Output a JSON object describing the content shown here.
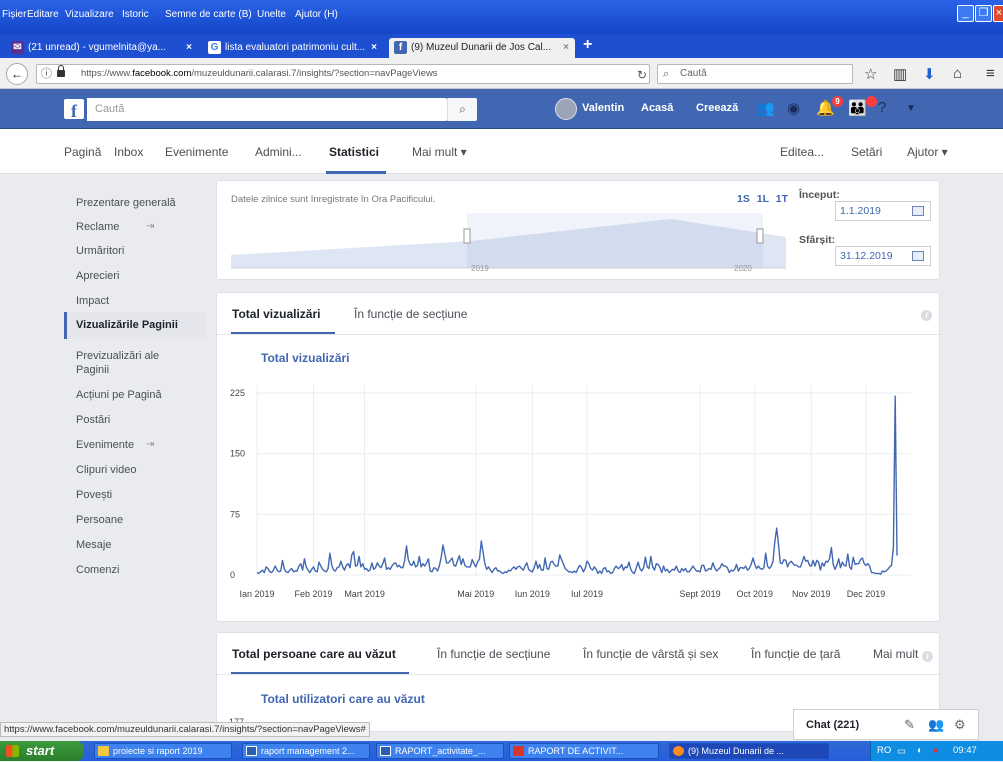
{
  "menubar": {
    "items": [
      "Fișier",
      "Editare",
      "Vizualizare",
      "Istoric",
      "Semne de carte (B)",
      "Unelte",
      "Ajutor (H)"
    ]
  },
  "tabs": [
    {
      "label": "(21 unread) - vgumelnita@ya...",
      "icon": "mail-icon"
    },
    {
      "label": "lista evaluatori patrimoniu cult...",
      "icon": "google-icon"
    },
    {
      "label": "(9) Muzeul Dunarii de Jos Cal...",
      "icon": "facebook-icon"
    }
  ],
  "navbar": {
    "url_prefix": "https://www.",
    "url_domain": "facebook.com",
    "url_path": "/muzeuldunarii.calarasi.7/insights/?section=navPageViews",
    "search_placeholder": "Caută"
  },
  "fb": {
    "search_placeholder": "Caută",
    "user_name": "Valentin",
    "home": "Acasă",
    "create": "Creează",
    "notif_count": "9"
  },
  "page_tabs": [
    "Pagină",
    "Inbox",
    "Evenimente",
    "Admini...",
    "Statistici",
    "Mai mult ▾",
    "Editea...",
    "Setări",
    "Ajutor ▾"
  ],
  "leftnav": [
    "Prezentare generală",
    "Reclame",
    "Urmăritori",
    "Aprecieri",
    "Impact",
    "Vizualizările Paginii",
    "Previzualizări ale Paginii",
    "Acțiuni pe Pagină",
    "Postări",
    "Evenimente",
    "Clipuri video",
    "Povești",
    "Persoane",
    "Mesaje",
    "Comenzi"
  ],
  "daterange": {
    "note": "Datele zilnice sunt înregistrate în Ora Pacificului.",
    "periods": "1S 1L 1T",
    "start_label": "Început:",
    "start_value": "1.1.2019",
    "end_label": "Sfârșit:",
    "end_value": "31.12.2019",
    "timeline_labels": [
      "2019",
      "2020"
    ]
  },
  "views_card": {
    "tab_total": "Total vizualizări",
    "tab_section": "În funcție de secțiune",
    "chart_title": "Total vizualizări"
  },
  "reach_card": {
    "tabs": [
      "Total persoane care au văzut",
      "În funcție de secțiune",
      "În funcție de vârstă și sex",
      "În funcție de țară",
      "Mai mult"
    ],
    "chart_title": "Total utilizatori care au văzut",
    "partial_tick": "177"
  },
  "chart_data": {
    "type": "line",
    "title": "Total vizualizări",
    "xlabel": "",
    "ylabel": "",
    "ylim": [
      0,
      225
    ],
    "yticks": [
      0,
      75,
      150,
      225
    ],
    "x_tick_labels": [
      "Ian 2019",
      "Feb 2019",
      "Mart 2019",
      "Mai 2019",
      "Iun 2019",
      "Iul 2019",
      "Sept 2019",
      "Oct 2019",
      "Nov 2019",
      "Dec 2019"
    ],
    "x_tick_days": [
      0,
      31,
      59,
      120,
      151,
      181,
      243,
      273,
      304,
      334
    ],
    "grid": true,
    "color": "#4267b2",
    "series": [
      {
        "values": [
          3,
          2,
          4,
          6,
          3,
          10,
          8,
          4,
          3,
          6,
          11,
          6,
          4,
          5,
          18,
          7,
          4,
          3,
          6,
          8,
          4,
          5,
          5,
          11,
          14,
          6,
          20,
          10,
          6,
          3,
          7,
          10,
          5,
          4,
          16,
          11,
          7,
          5,
          4,
          8,
          27,
          12,
          6,
          5,
          9,
          10,
          17,
          10,
          6,
          12,
          14,
          9,
          25,
          29,
          11,
          12,
          23,
          10,
          14,
          7,
          8,
          5,
          6,
          15,
          7,
          9,
          15,
          11,
          9,
          14,
          21,
          7,
          9,
          7,
          11,
          14,
          15,
          10,
          12,
          9,
          9,
          18,
          36,
          19,
          13,
          12,
          17,
          10,
          12,
          23,
          10,
          14,
          11,
          15,
          20,
          5,
          4,
          9,
          8,
          5,
          11,
          22,
          37,
          26,
          15,
          15,
          18,
          21,
          12,
          11,
          18,
          24,
          13,
          20,
          12,
          10,
          10,
          10,
          19,
          14,
          10,
          16,
          20,
          42,
          28,
          14,
          7,
          10,
          6,
          3,
          7,
          9,
          5,
          5,
          3,
          2,
          4,
          3,
          6,
          5,
          8,
          10,
          7,
          10,
          11,
          8,
          6,
          11,
          15,
          7,
          5,
          4,
          9,
          17,
          8,
          13,
          6,
          6,
          21,
          8,
          7,
          16,
          17,
          13,
          11,
          11,
          25,
          19,
          14,
          8,
          6,
          4,
          4,
          3,
          5,
          3,
          8,
          12,
          9,
          4,
          8,
          17,
          14,
          8,
          6,
          10,
          7,
          2,
          5,
          2,
          8,
          9,
          4,
          5,
          2,
          3,
          8,
          11,
          8,
          9,
          13,
          6,
          10,
          9,
          16,
          7,
          3,
          2,
          9,
          16,
          8,
          5,
          9,
          22,
          10,
          8,
          23,
          10,
          6,
          14,
          13,
          9,
          3,
          11,
          5,
          7,
          3,
          5,
          7,
          6,
          11,
          5,
          3,
          8,
          5,
          8,
          4,
          4,
          7,
          11,
          8,
          5,
          5,
          4,
          12,
          12,
          5,
          6,
          8,
          7,
          15,
          9,
          5,
          7,
          9,
          14,
          11,
          11,
          9,
          3,
          6,
          5,
          7,
          13,
          5,
          9,
          9,
          8,
          11,
          6,
          8,
          13,
          21,
          13,
          8,
          11,
          8,
          7,
          9,
          27,
          11,
          8,
          11,
          17,
          41,
          58,
          38,
          15,
          14,
          19,
          18,
          10,
          15,
          17,
          14,
          12,
          12,
          10,
          10,
          16,
          23,
          17,
          18,
          12,
          11,
          18,
          11,
          18,
          16,
          6,
          15,
          11,
          17,
          16,
          20,
          34,
          13,
          7,
          12,
          20,
          9,
          16,
          12,
          11,
          26,
          10,
          7,
          22,
          13,
          14,
          14,
          19,
          21,
          14,
          12,
          14,
          11,
          3,
          3,
          2,
          2,
          2,
          1,
          5,
          4,
          5,
          7,
          10,
          12,
          34,
          221,
          24
        ]
      }
    ]
  },
  "status_url": "https://www.facebook.com/muzeuldunarii.calarasi.7/insights/?section=navPageViews#",
  "chat": {
    "label": "Chat (221)"
  },
  "taskbar": {
    "start": "start",
    "tasks": [
      "proiecte si raport 2019",
      "raport management 2...",
      "RAPORT_activitate_...",
      "RAPORT DE ACTIVIT...",
      "(9) Muzeul Dunarii de ..."
    ],
    "lang": "RO",
    "time": "09:47"
  }
}
